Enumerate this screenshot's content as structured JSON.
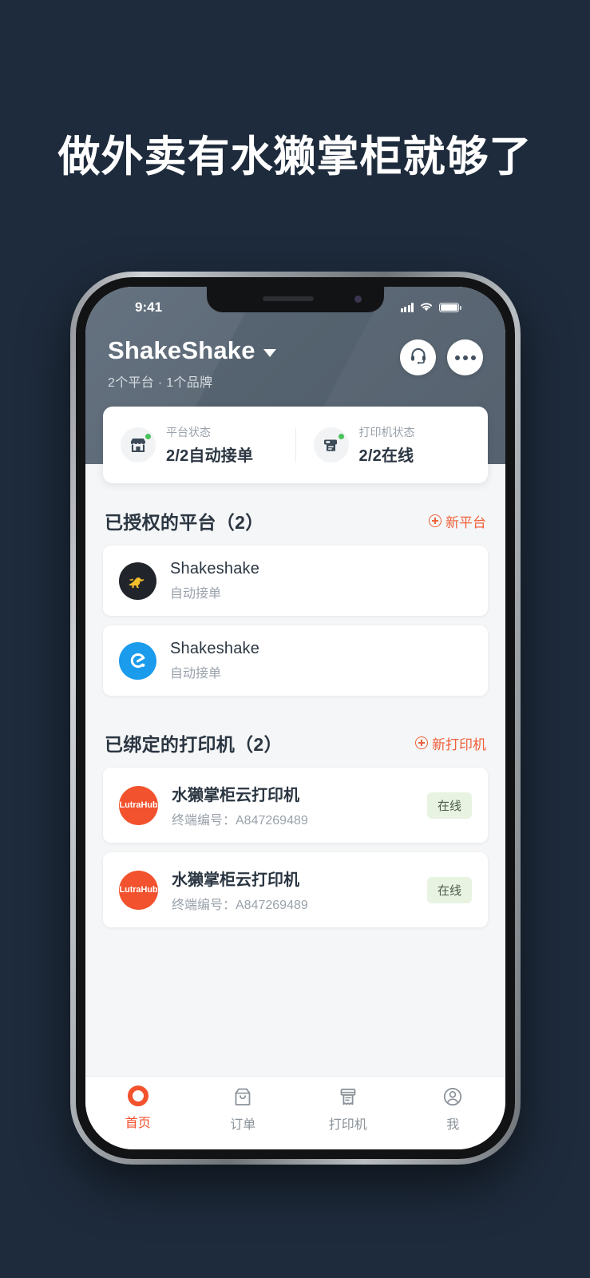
{
  "promo": {
    "headline": "做外卖有水獭掌柜就够了",
    "background_color": "#1e2b3c"
  },
  "status_bar": {
    "time": "9:41",
    "signal_icon": "signal-bars-icon",
    "wifi_icon": "wifi-icon",
    "battery_icon": "battery-full-icon"
  },
  "app_header": {
    "brand_name": "ShakeShake",
    "brand_caret_icon": "chevron-down-icon",
    "subtitle": "2个平台 · 1个品牌",
    "support_icon": "headset-icon",
    "more_icon": "more-dots-icon",
    "background_color": "#55626f"
  },
  "status_card": {
    "cells": [
      {
        "icon": "storefront-icon",
        "label": "平台状态",
        "value": "2/2自动接单",
        "dot_color": "#49c35a"
      },
      {
        "icon": "printer-icon",
        "label": "打印机状态",
        "value": "2/2在线",
        "dot_color": "#49c35a"
      }
    ]
  },
  "platform_section": {
    "title": "已授权的平台（2）",
    "action_label": "新平台",
    "action_icon": "plus-circle-icon",
    "action_color": "#f0603c",
    "items": [
      {
        "logo": "meituan-kangaroo-logo",
        "name": "Shakeshake",
        "status": "自动接单",
        "logo_bg": "#22242b"
      },
      {
        "logo": "eleme-e-logo",
        "name": "Shakeshake",
        "status": "自动接单",
        "logo_bg": "#1b9bec"
      }
    ]
  },
  "printer_section": {
    "title": "已绑定的打印机（2）",
    "action_label": "新打印机",
    "action_icon": "plus-circle-icon",
    "action_color": "#f0603c",
    "items": [
      {
        "logo_text": "LutraHub",
        "name": "水獭掌柜云打印机",
        "serial": "终端编号：A847269489",
        "badge": "在线",
        "badge_bg": "#e8f3e2"
      },
      {
        "logo_text": "LutraHub",
        "name": "水獭掌柜云打印机",
        "serial": "终端编号：A847269489",
        "badge": "在线",
        "badge_bg": "#e8f3e2"
      }
    ]
  },
  "tab_bar": {
    "active_color": "#f2522d",
    "inactive_color": "#8b9299",
    "tabs": [
      {
        "label": "首页",
        "icon": "home-ring-icon",
        "active": true
      },
      {
        "label": "订单",
        "icon": "bag-icon",
        "active": false
      },
      {
        "label": "打印机",
        "icon": "printer-icon",
        "active": false
      },
      {
        "label": "我",
        "icon": "person-icon",
        "active": false
      }
    ]
  }
}
